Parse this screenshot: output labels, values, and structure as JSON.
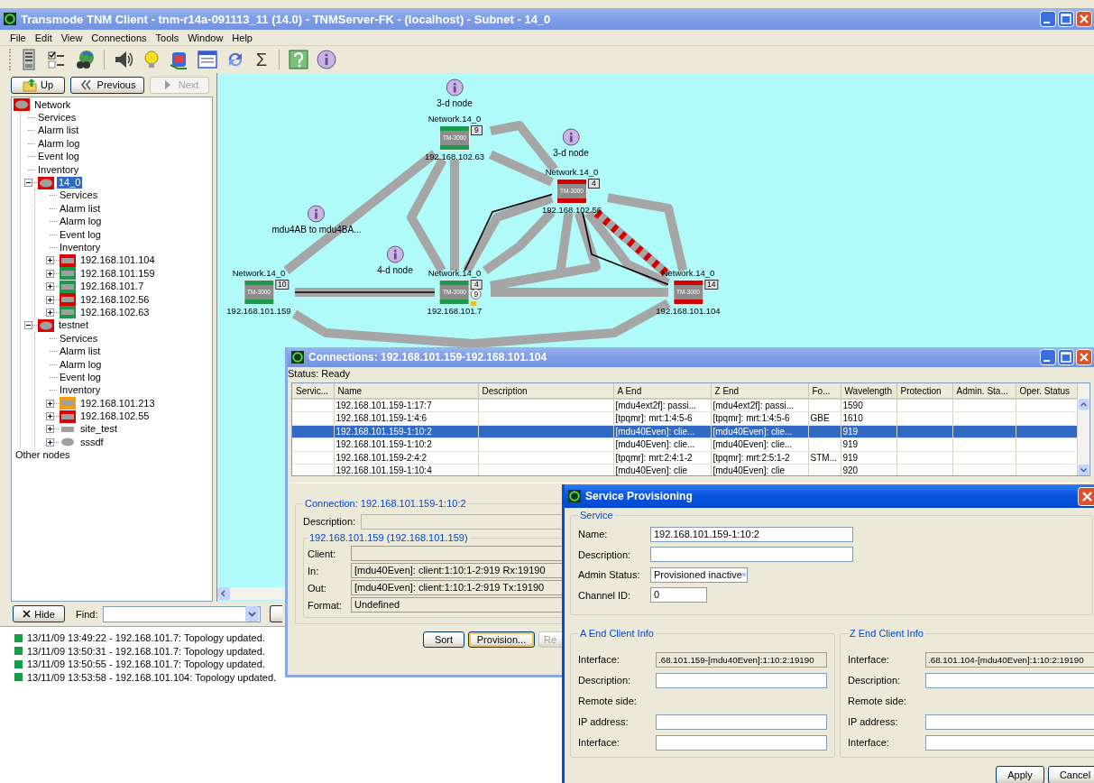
{
  "window": {
    "title": "Transmode TNM Client - tnm-r14a-091113_11 (14.0) - TNMServer-FK - (localhost) - Subnet  - 14_0"
  },
  "menu": [
    "File",
    "Edit",
    "View",
    "Connections",
    "Tools",
    "Window",
    "Help"
  ],
  "toolbar": {
    "sum_label": "Σ"
  },
  "nav_buttons": [
    {
      "kind": "up",
      "label": "Up",
      "disabled": false
    },
    {
      "kind": "back",
      "label": "Previous",
      "disabled": false
    },
    {
      "kind": "forward",
      "label": "Next",
      "disabled": true
    }
  ],
  "tree": [
    {
      "kind": "network",
      "label": "Network",
      "color": "#e00000",
      "selected": false,
      "children": [
        {
          "kind": "view",
          "label": "Services",
          "selected": false
        },
        {
          "kind": "view",
          "label": "Alarm list",
          "selected": false
        },
        {
          "kind": "view",
          "label": "Alarm log",
          "selected": false
        },
        {
          "kind": "view",
          "label": "Event log",
          "selected": false
        },
        {
          "kind": "view",
          "label": "Inventory",
          "selected": false
        },
        {
          "kind": "network",
          "label": "14_0",
          "color": "#e00000",
          "selected": true,
          "expanded": true,
          "children": [
            {
              "kind": "view",
              "label": "Services",
              "selected": false
            },
            {
              "kind": "view",
              "label": "Alarm list",
              "selected": false
            },
            {
              "kind": "view",
              "label": "Alarm log",
              "selected": false
            },
            {
              "kind": "view",
              "label": "Event log",
              "selected": false
            },
            {
              "kind": "view",
              "label": "Inventory",
              "selected": false
            },
            {
              "kind": "node",
              "label": "192.168.101.104",
              "color": "#e00000",
              "selected": false,
              "expanded": false
            },
            {
              "kind": "node",
              "label": "192.168.101.159",
              "color": "#1a9a4a",
              "selected": false,
              "expanded": false
            },
            {
              "kind": "node",
              "label": "192.168.101.7",
              "color": "#1a9a4a",
              "selected": false,
              "expanded": false
            },
            {
              "kind": "node",
              "label": "192.168.102.56",
              "color": "#e00000",
              "selected": false,
              "expanded": false
            },
            {
              "kind": "node",
              "label": "192.168.102.63",
              "color": "#1a9a4a",
              "selected": false,
              "expanded": false
            }
          ]
        },
        {
          "kind": "network",
          "label": "testnet",
          "color": "#e00000",
          "selected": false,
          "expanded": true,
          "children": [
            {
              "kind": "view",
              "label": "Services",
              "selected": false
            },
            {
              "kind": "view",
              "label": "Alarm list",
              "selected": false
            },
            {
              "kind": "view",
              "label": "Alarm log",
              "selected": false
            },
            {
              "kind": "view",
              "label": "Event log",
              "selected": false
            },
            {
              "kind": "view",
              "label": "Inventory",
              "selected": false
            },
            {
              "kind": "node",
              "label": "192.168.101.213",
              "color": "#f5a000",
              "selected": false,
              "expanded": false
            },
            {
              "kind": "node",
              "label": "192.168.102.55",
              "color": "#e00000",
              "selected": false,
              "expanded": false
            },
            {
              "kind": "node",
              "label": "site_test",
              "selected": false,
              "expanded": false
            },
            {
              "kind": "network",
              "label": "sssdf",
              "selected": false,
              "expanded": false
            }
          ]
        }
      ]
    },
    {
      "kind": "view",
      "label": "Other nodes",
      "selected": false
    }
  ],
  "map": {
    "nodes": [
      {
        "network": "Network.14_0",
        "count": "9",
        "model": "TM-3000",
        "ip": "192.168.102.63",
        "color": "#1a9a4a"
      },
      {
        "network": "Network.14_0",
        "count": "4",
        "model": "TM-3000",
        "ip": "192.168.102.56",
        "color": "#d40000"
      },
      {
        "network": "Network.14_0",
        "count": "10",
        "model": "TM-3000",
        "ip": "192.168.101.159",
        "color": "#1a9a4a"
      },
      {
        "network": "Network.14_0",
        "count": "4",
        "model": "TM-3000",
        "ip": "192.168.101.7",
        "color": "#1a9a4a",
        "alarm_count": "9"
      },
      {
        "network": "Network.14_0",
        "count": "14",
        "model": "TM-3000",
        "ip": "192.168.101.104",
        "color": "#d40000"
      }
    ],
    "notes": [
      {
        "label": "3-d node"
      },
      {
        "label": "3-d node"
      },
      {
        "label": "mdu4AB to mdu4BA..."
      },
      {
        "label": "4-d node"
      }
    ]
  },
  "find_bar": {
    "hide_label": "Hide",
    "find_label": "Find:"
  },
  "log": [
    {
      "color": "#1a9a4a",
      "text": "13/11/09 13:49:22 - 192.168.101.7: Topology updated."
    },
    {
      "color": "#1a9a4a",
      "text": "13/11/09 13:50:31 - 192.168.101.7: Topology updated."
    },
    {
      "color": "#1a9a4a",
      "text": "13/11/09 13:50:55 - 192.168.101.7: Topology updated."
    },
    {
      "color": "#1a9a4a",
      "text": "13/11/09 13:53:58 - 192.168.101.104: Topology updated."
    }
  ],
  "connections_window": {
    "title": "Connections: 192.168.101.159-192.168.101.104",
    "status": "Status: Ready",
    "columns": [
      "Servic...",
      "Name",
      "Description",
      "A End",
      "Z End",
      "Fo...",
      "Wavelength",
      "Protection",
      "Admin. Sta...",
      "Oper. Status"
    ],
    "rows": [
      {
        "selected": false,
        "name": "192.168.101.159-1:17:7",
        "a_end": "[mdu4ext2f]: passi...",
        "z_end": "[mdu4ext2f]: passi...",
        "wavelength": "1590"
      },
      {
        "selected": false,
        "name": "192.168.101.159-1:4:6",
        "a_end": "[tpqmr]: mrt:1:4:5-6",
        "z_end": "[tpqmr]: mrt:1:4:5-6",
        "format": "GBE",
        "wavelength": "1610"
      },
      {
        "selected": true,
        "name": "192.168.101.159-1:10:2",
        "a_end": "[mdu40Even]: clie...",
        "z_end": "[mdu40Even]: clie...",
        "wavelength": "919"
      },
      {
        "selected": false,
        "name": "192.168.101.159-1:10:2",
        "a_end": "[mdu40Even]: clie...",
        "z_end": "[mdu40Even]: clie...",
        "wavelength": "919"
      },
      {
        "selected": false,
        "name": "192.168.101.159-2:4:2",
        "a_end": "[tpqmr]: mrt:2:4:1-2",
        "z_end": "[tpqmr]: mrt:2:5:1-2",
        "format": "STM...",
        "wavelength": "919"
      },
      {
        "selected": false,
        "name": "192.168.101.159-1:10:4",
        "a_end": "[mdu40Even]: clie",
        "z_end": "[mdu40Even]: clie",
        "wavelength": "920"
      }
    ],
    "details": {
      "title": "Connection: 192.168.101.159-1:10:2",
      "description_label": "Description:",
      "endpoint_title": "192.168.101.159 (192.168.101.159)",
      "fields": [
        {
          "label": "Client:"
        },
        {
          "label": "In:",
          "value": "[mdu40Even]: client:1:10:1-2:919 Rx:19190"
        },
        {
          "label": "Out:",
          "value": "[mdu40Even]: client:1:10:1-2:919 Tx:19190"
        },
        {
          "label": "Format:",
          "value": "Undefined"
        }
      ]
    },
    "buttons": [
      {
        "label": "Sort",
        "default": false
      },
      {
        "label": "Provision...",
        "default": true
      },
      {
        "label": "Re",
        "default": false
      }
    ]
  },
  "provisioning_window": {
    "title": "Service Provisioning",
    "service_title": "Service",
    "fields": [
      {
        "kind": "text",
        "label": "Name:",
        "value": "192.168.101.159-1:10:2"
      },
      {
        "kind": "text",
        "label": "Description:"
      },
      {
        "kind": "select",
        "label": "Admin Status:",
        "value": "Provisioned inactive"
      },
      {
        "kind": "short",
        "label": "Channel ID:",
        "value": "0"
      }
    ],
    "ends": [
      {
        "title": "A End Client Info",
        "fields": [
          {
            "kind": "readonly",
            "label": "Interface:",
            "value": ".68.101.159-[mdu40Even]:1:10:2:19190"
          },
          {
            "kind": "text",
            "label": "Description:"
          },
          {
            "kind": "caption",
            "label": "Remote side:"
          },
          {
            "kind": "text",
            "label": "IP address:"
          },
          {
            "kind": "text",
            "label": "Interface:"
          }
        ]
      },
      {
        "title": "Z End Client Info",
        "fields": [
          {
            "kind": "readonly",
            "label": "Interface:",
            "value": ".68.101.104-[mdu40Even]:1:10:2:19190"
          },
          {
            "kind": "text",
            "label": "Description:"
          },
          {
            "kind": "caption",
            "label": "Remote side:"
          },
          {
            "kind": "text",
            "label": "IP address:"
          },
          {
            "kind": "text",
            "label": "Interface:"
          }
        ]
      }
    ],
    "buttons": [
      "Apply",
      "Cancel"
    ]
  }
}
